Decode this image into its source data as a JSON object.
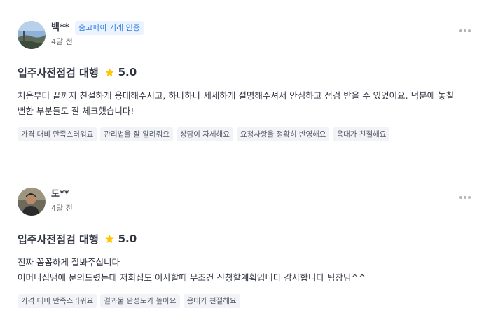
{
  "reviews": [
    {
      "user": "백**",
      "badge": "숨고페이 거래 인증",
      "date": "4달 전",
      "service": "입주사전점검 대행",
      "rating": "5.0",
      "text": "처음부터 끝까지 친절하게 응대해주시고, 하나하나 세세하게 설명해주셔서 안심하고 점검 받을 수 있었어요. 덕분에 놓칠\n뻔한 부분들도 잘 체크했습니다!",
      "tags": [
        "가격 대비 만족스러워요",
        "관리법을 잘 알려줘요",
        "상담이 자세해요",
        "요청사항을 정확히 반영해요",
        "응대가 친절해요"
      ],
      "avatar": "landscape-photo"
    },
    {
      "user": "도**",
      "date": "4달 전",
      "service": "입주사전점검 대행",
      "rating": "5.0",
      "text": "진짜 꼼꼼하게 잘봐주십니다\n어머니집땜에 문의드렸는데 저희집도 이사할때 무조건 신청할계획입니다 감사합니다 팀장님^^",
      "tags": [
        "가격 대비 만족스러워요",
        "결과물 완성도가 높아요",
        "응대가 친절해요"
      ],
      "avatar": "person-photo"
    }
  ],
  "colors": {
    "star": "#ffc600",
    "badge_text": "#2e7de0",
    "badge_bg": "#eaf3ff",
    "tag_bg": "#f2f3f6"
  },
  "icons": [
    "more-options-icon",
    "star-icon"
  ]
}
